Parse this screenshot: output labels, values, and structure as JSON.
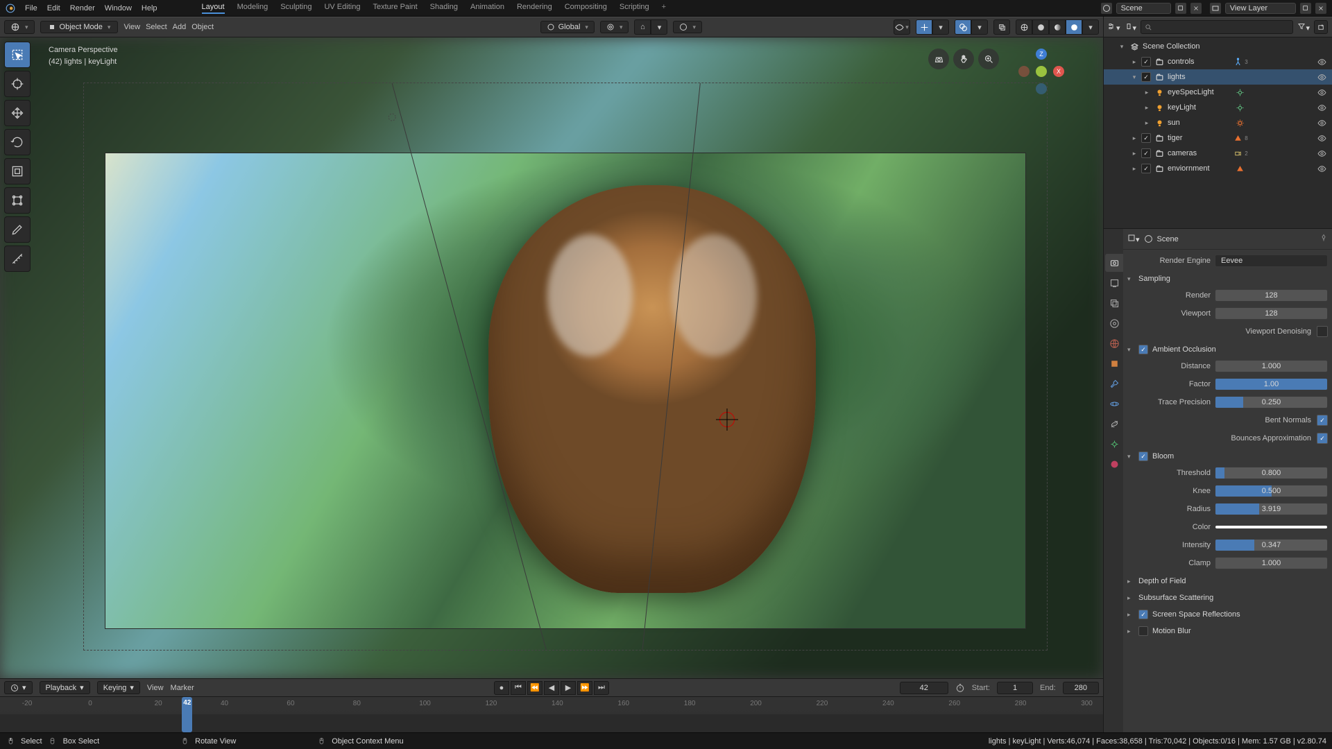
{
  "topbar": {
    "menus": [
      "File",
      "Edit",
      "Render",
      "Window",
      "Help"
    ],
    "tabs": [
      "Layout",
      "Modeling",
      "Sculpting",
      "UV Editing",
      "Texture Paint",
      "Shading",
      "Animation",
      "Rendering",
      "Compositing",
      "Scripting"
    ],
    "active_tab": 0,
    "scene_name": "Scene",
    "view_layer_name": "View Layer"
  },
  "viewport_header": {
    "mode": "Object Mode",
    "menus": [
      "View",
      "Select",
      "Add",
      "Object"
    ],
    "orientation": "Global"
  },
  "viewport_overlay": {
    "line1": "Camera Perspective",
    "line2": "(42) lights | keyLight"
  },
  "nav_axis": {
    "x": "X",
    "y": "",
    "z": "Z"
  },
  "outliner": {
    "root": "Scene Collection",
    "tree": [
      {
        "level": 1,
        "expand": "▸",
        "checked": true,
        "icon": "coll",
        "label": "controls",
        "trailing_icon": "arma",
        "trailing_badge": "3",
        "selected": false,
        "eye": true
      },
      {
        "level": 1,
        "expand": "▾",
        "checked": true,
        "icon": "coll",
        "label": "lights",
        "selected": true,
        "eye": true
      },
      {
        "level": 2,
        "expand": "▸",
        "checked": null,
        "icon": "light",
        "label": "eyeSpecLight",
        "trailing_icon": "lightdata",
        "selected": false,
        "eye": true
      },
      {
        "level": 2,
        "expand": "▸",
        "checked": null,
        "icon": "light",
        "label": "keyLight",
        "trailing_icon": "lightdata",
        "selected": false,
        "eye": true
      },
      {
        "level": 2,
        "expand": "▸",
        "checked": null,
        "icon": "light",
        "label": "sun",
        "trailing_icon": "lightdata-sun",
        "selected": false,
        "eye": true
      },
      {
        "level": 1,
        "expand": "▸",
        "checked": true,
        "icon": "coll",
        "label": "tiger",
        "trailing_icon": "mesh",
        "trailing_badge": "8",
        "selected": false,
        "eye": true
      },
      {
        "level": 1,
        "expand": "▸",
        "checked": true,
        "icon": "coll",
        "label": "cameras",
        "trailing_icon": "cam",
        "trailing_badge": "2",
        "selected": false,
        "eye": true
      },
      {
        "level": 1,
        "expand": "▸",
        "checked": true,
        "icon": "coll",
        "label": "enviornment",
        "trailing_icon": "mesh",
        "selected": false,
        "eye": true
      }
    ]
  },
  "properties": {
    "breadcrumb": "Scene",
    "render_engine_label": "Render Engine",
    "render_engine": "Eevee",
    "panels": {
      "sampling": {
        "title": "Sampling",
        "render_label": "Render",
        "render": "128",
        "viewport_label": "Viewport",
        "viewport": "128",
        "denoising_label": "Viewport Denoising",
        "denoising": false
      },
      "ao": {
        "title": "Ambient Occlusion",
        "enabled": true,
        "distance_label": "Distance",
        "distance": "1.000",
        "factor_label": "Factor",
        "factor": "1.00",
        "factor_fill": 1.0,
        "trace_label": "Trace Precision",
        "trace": "0.250",
        "trace_fill": 0.25,
        "bent_label": "Bent Normals",
        "bent": true,
        "bounces_label": "Bounces Approximation",
        "bounces": true
      },
      "bloom": {
        "title": "Bloom",
        "enabled": true,
        "threshold_label": "Threshold",
        "threshold": "0.800",
        "threshold_fill": 0.08,
        "knee_label": "Knee",
        "knee": "0.500",
        "knee_fill": 0.5,
        "radius_label": "Radius",
        "radius": "3.919",
        "radius_fill": 0.39,
        "color_label": "Color",
        "intensity_label": "Intensity",
        "intensity": "0.347",
        "intensity_fill": 0.347,
        "clamp_label": "Clamp",
        "clamp": "1.000"
      },
      "dof": {
        "title": "Depth of Field"
      },
      "sss": {
        "title": "Subsurface Scattering"
      },
      "ssr": {
        "title": "Screen Space Reflections",
        "enabled": true
      },
      "motionblur": {
        "title": "Motion Blur",
        "enabled": false
      }
    }
  },
  "timeline": {
    "menus": [
      "Playback",
      "Keying",
      "View",
      "Marker"
    ],
    "current_frame": "42",
    "start_label": "Start:",
    "start": "1",
    "end_label": "End:",
    "end": "280",
    "ticks": [
      "-20",
      "0",
      "20",
      "40",
      "60",
      "80",
      "100",
      "120",
      "140",
      "160",
      "180",
      "200",
      "220",
      "240",
      "260",
      "280",
      "300"
    ],
    "playhead_pos_pct": 16.5
  },
  "statusbar": {
    "left_select": "Select",
    "left_box": "Box Select",
    "left_rotate": "Rotate View",
    "left_menu": "Object Context Menu",
    "right": "lights | keyLight | Verts:46,074 | Faces:38,658 | Tris:70,042 | Objects:0/16 | Mem: 1.57 GB | v2.80.74"
  }
}
